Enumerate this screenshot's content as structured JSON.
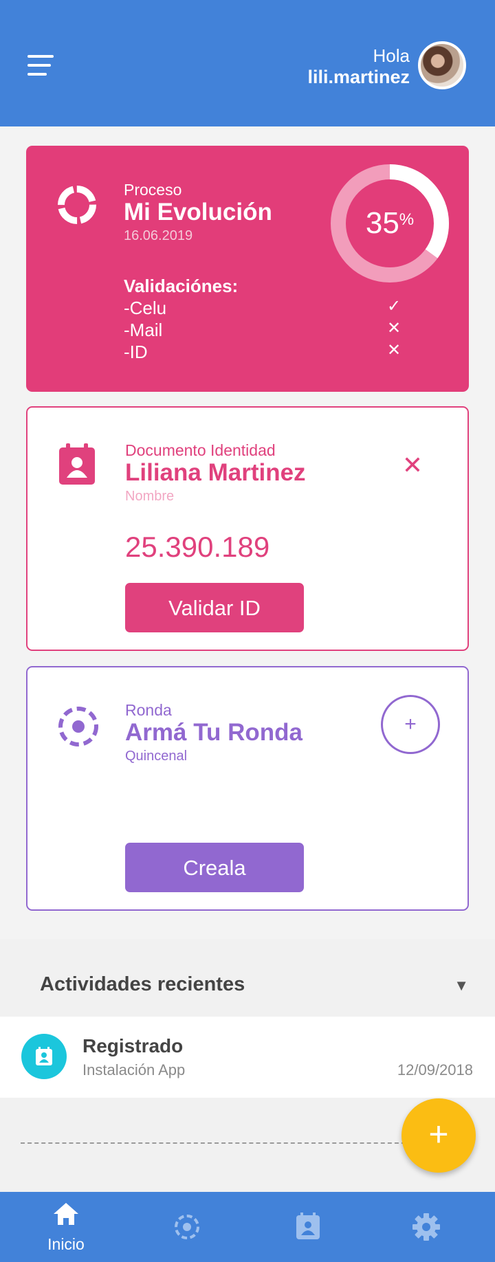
{
  "header": {
    "greeting": "Hola",
    "username": "lili.martinez"
  },
  "evolution": {
    "caption": "Proceso",
    "title": "Mi Evolución",
    "date": "16.06.2019",
    "progress_percent": 35,
    "progress_number": "35",
    "progress_symbol": "%",
    "validations_title": "Validaciónes:",
    "validations": [
      {
        "label": "-Celu",
        "status": "✓",
        "done": true
      },
      {
        "label": "-Mail",
        "status": "✕",
        "done": false
      },
      {
        "label": "-ID",
        "status": "✕",
        "done": false
      }
    ]
  },
  "document": {
    "caption": "Documento Identidad",
    "name": "Liliana Martinez",
    "sublabel": "Nombre",
    "number": "25.390.189",
    "button_label": "Validar ID",
    "close_glyph": "✕"
  },
  "ronda": {
    "caption": "Ronda",
    "title": "Armá Tu Ronda",
    "sublabel": "Quincenal",
    "add_glyph": "+",
    "button_label": "Creala"
  },
  "activities": {
    "title": "Actividades recientes",
    "toggle_glyph": "▼",
    "items": [
      {
        "title": "Registrado",
        "detail": "Instalación App",
        "date": "12/09/2018",
        "icon": "contact-calendar-icon"
      }
    ]
  },
  "fab": {
    "glyph": "+"
  },
  "nav": {
    "items": [
      {
        "label": "Inicio",
        "icon": "home-icon",
        "active": true
      },
      {
        "label": "",
        "icon": "ronda-icon",
        "active": false
      },
      {
        "label": "",
        "icon": "contact-calendar-icon",
        "active": false
      },
      {
        "label": "",
        "icon": "gear-icon",
        "active": false
      }
    ]
  },
  "colors": {
    "header": "#4282d9",
    "evolution": "#e23d79",
    "document": "#e0417d",
    "ronda": "#9168d0",
    "activity_icon": "#1bc6dc",
    "fab": "#fbbd13"
  }
}
